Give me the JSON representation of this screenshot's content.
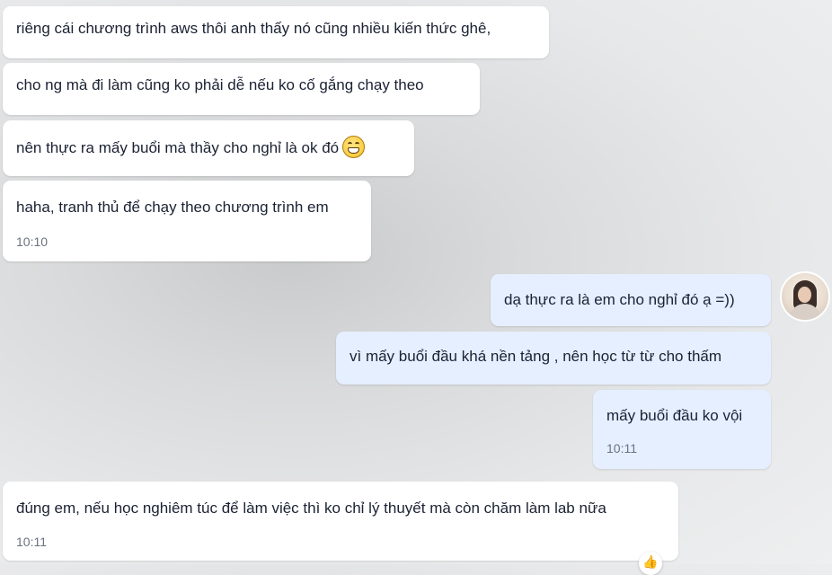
{
  "messages": [
    {
      "text": "riêng cái chương trình aws thôi anh thấy nó cũng nhiều kiến thức ghê,"
    },
    {
      "text": "cho ng mà đi làm cũng ko phải dễ nếu ko cố gắng chạy theo"
    },
    {
      "text": "nên thực ra mấy buổi mà thầy cho nghỉ là ok đó",
      "emoji": "grinning-face-icon"
    },
    {
      "text": "haha, tranh thủ để chạy theo chương trình em",
      "time": "10:10"
    },
    {
      "text": "dạ thực ra là em cho nghỉ đó ạ =))"
    },
    {
      "text": "vì mấy buổi đầu khá nền tảng , nên học từ từ cho thấm"
    },
    {
      "text": "mấy buổi đầu ko vội",
      "time": "10:11"
    },
    {
      "text": "đúng em, nếu học nghiêm túc để làm việc thì ko chỉ lý thuyết mà còn chăm làm lab nữa",
      "time": "10:11"
    }
  ],
  "avatar": {
    "icon": "user-avatar"
  },
  "reaction": {
    "icon": "thumbs-up-icon",
    "glyph": "👍"
  },
  "colors": {
    "incoming_bubble": "#ffffff",
    "outgoing_bubble": "#e5efff",
    "text": "#1a2233",
    "timestamp": "#6b7280"
  }
}
